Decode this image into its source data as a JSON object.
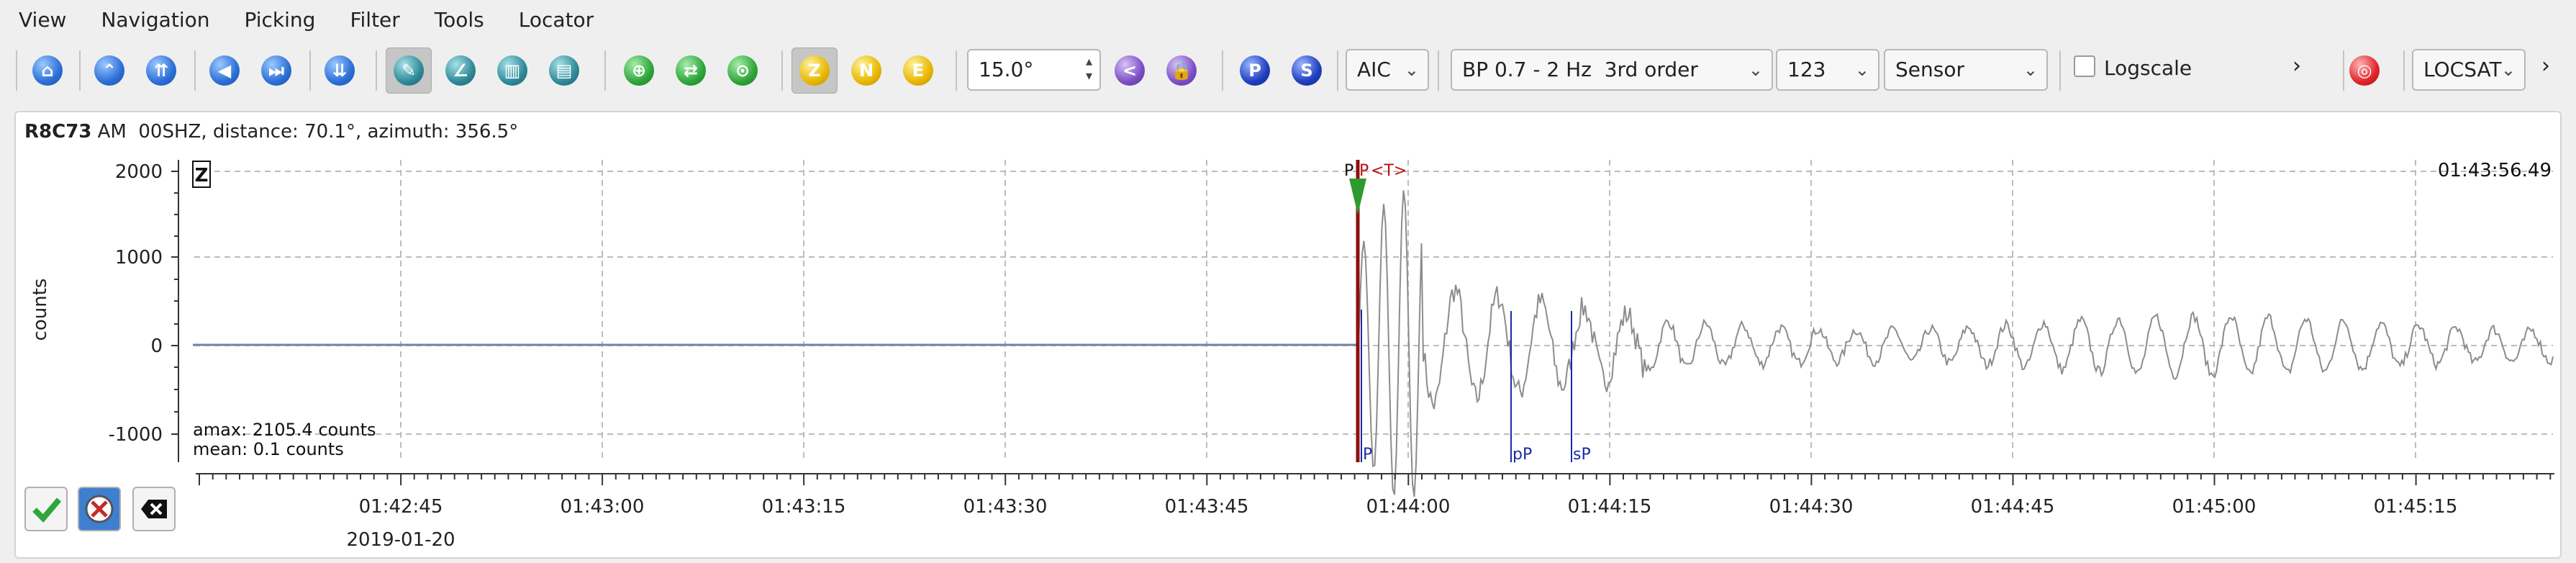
{
  "menu": [
    "View",
    "Navigation",
    "Picking",
    "Filter",
    "Tools",
    "Locator"
  ],
  "toolbar": {
    "zoom_value": "15.0°",
    "picker_method": "AIC",
    "filter": "BP 0.7 - 2 Hz  3rd order",
    "channel_set": "123",
    "unit": "Sensor",
    "logscale_label": "Logscale",
    "logscale_checked": false,
    "locator": "LOCSAT",
    "comp_buttons": {
      "z": "Z",
      "n": "N",
      "e": "E"
    },
    "phase_buttons": {
      "p": "P",
      "s": "S"
    },
    "colors": {
      "accent_blue": "#2c6fd6",
      "green": "#2fa63a",
      "yellow": "#e8b700",
      "navy": "#1f3fbf",
      "red": "#e0262b"
    }
  },
  "trace": {
    "station": "R8C73",
    "header_rest": "AM  00SHZ, distance: 70.1°, azimuth: 356.5°",
    "component_label": "Z",
    "end_time": "01:43:56.49",
    "ylabel": "counts",
    "yticks": [
      "2000",
      "1000",
      "0",
      "-1000"
    ],
    "amax": "amax: 2105.4 counts",
    "mean": "mean: 0.1 counts",
    "pick_labels": {
      "top_p1": "P",
      "top_p2": "P",
      "top_t": "<T>",
      "bottom_p": "P",
      "bottom_pp": "pP",
      "bottom_sp": "sP"
    },
    "xticks": [
      "01:42:45",
      "01:43:00",
      "01:43:15",
      "01:43:30",
      "01:43:45",
      "01:44:00",
      "01:44:15",
      "01:44:30",
      "01:44:45",
      "01:45:00",
      "01:45:15"
    ],
    "date": "2019-01-20"
  },
  "chart_data": {
    "type": "line",
    "ylabel": "counts",
    "ylim": [
      -1300,
      2100
    ],
    "yticks": [
      2000,
      1000,
      0,
      -1000
    ],
    "x": [
      "01:42:45",
      "01:43:00",
      "01:43:15",
      "01:43:30",
      "01:43:45",
      "01:44:00",
      "01:44:15",
      "01:44:30",
      "01:44:45",
      "01:45:00",
      "01:45:15"
    ],
    "grid": true,
    "series": [
      {
        "color": "#8a8a8a"
      }
    ]
  }
}
